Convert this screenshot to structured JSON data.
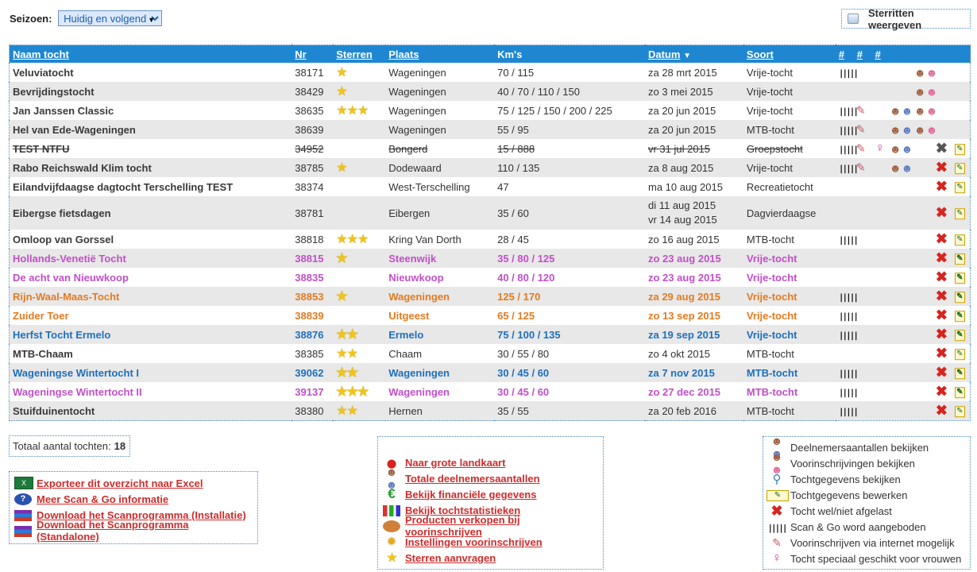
{
  "season": {
    "label": "Seizoen:",
    "selected": "Huidig en volgend"
  },
  "stars_toggle": {
    "label": "Sterritten weergeven"
  },
  "table": {
    "headers": {
      "naam": "Naam tocht",
      "nr": "Nr",
      "sterren": "Sterren",
      "plaats": "Plaats",
      "kms": "Km's",
      "datum": "Datum",
      "soort": "Soort",
      "h1": "#",
      "h2": "#",
      "h3": "#"
    },
    "rows": [
      {
        "naam": "Veluviatocht",
        "nr": "38171",
        "stars": 1,
        "plaats": "Wageningen",
        "kms": "70 / 115",
        "datum": "za 28 mrt 2015",
        "datum2": "",
        "soort": "Vrije-tocht",
        "style": "",
        "bg": 0,
        "icons": {
          "scan": true,
          "pencil": false,
          "female": false,
          "people1": false,
          "people2": true,
          "x": "",
          "edit": false
        }
      },
      {
        "naam": "Bevrijdingstocht",
        "nr": "38429",
        "stars": 1,
        "plaats": "Wageningen",
        "kms": "40 / 70 / 110 / 150",
        "datum": "zo 3 mei 2015",
        "datum2": "",
        "soort": "Vrije-tocht",
        "style": "",
        "bg": 1,
        "icons": {
          "scan": false,
          "pencil": false,
          "female": false,
          "people1": false,
          "people2": true,
          "x": "",
          "edit": false
        }
      },
      {
        "naam": "Jan Janssen Classic",
        "nr": "38635",
        "stars": 3,
        "plaats": "Wageningen",
        "kms": "75 / 125 / 150 / 200 / 225",
        "datum": "za 20 jun 2015",
        "datum2": "",
        "soort": "Vrije-tocht",
        "style": "",
        "bg": 0,
        "icons": {
          "scan": true,
          "pencil": true,
          "female": false,
          "people1": true,
          "people2": true,
          "x": "",
          "edit": false
        }
      },
      {
        "naam": "Hel van Ede-Wageningen",
        "nr": "38639",
        "stars": 0,
        "plaats": "Wageningen",
        "kms": "55 / 95",
        "datum": "za 20 jun 2015",
        "datum2": "",
        "soort": "MTB-tocht",
        "style": "",
        "bg": 1,
        "icons": {
          "scan": true,
          "pencil": true,
          "female": false,
          "people1": true,
          "people2": true,
          "x": "",
          "edit": false
        }
      },
      {
        "naam": "TEST NTFU",
        "nr": "34952",
        "stars": 0,
        "plaats": "Bongerd",
        "kms": "15 / 888",
        "datum": "vr 31 jul 2015",
        "datum2": "",
        "soort": "Groepstocht",
        "style": "strike",
        "bg": 0,
        "icons": {
          "scan": true,
          "pencil": true,
          "female": true,
          "people1": true,
          "people2": false,
          "x": "gray",
          "edit": true
        }
      },
      {
        "naam": "Rabo Reichswald Klim tocht",
        "nr": "38785",
        "stars": 1,
        "plaats": "Dodewaard",
        "kms": "110 / 135",
        "datum": "za 8 aug 2015",
        "datum2": "",
        "soort": "Vrije-tocht",
        "style": "",
        "bg": 1,
        "icons": {
          "scan": true,
          "pencil": true,
          "female": false,
          "people1": true,
          "people2": false,
          "x": "red",
          "edit": true
        }
      },
      {
        "naam": "Eilandvijfdaagse dagtocht Terschelling TEST",
        "nr": "38374",
        "stars": 0,
        "plaats": "West-Terschelling",
        "kms": "47",
        "datum": "ma 10 aug 2015",
        "datum2": "",
        "soort": "Recreatietocht",
        "style": "",
        "bg": 0,
        "icons": {
          "scan": false,
          "pencil": false,
          "female": false,
          "people1": false,
          "people2": false,
          "x": "red",
          "edit": true
        }
      },
      {
        "naam": "Eibergse fietsdagen",
        "nr": "38781",
        "stars": 0,
        "plaats": "Eibergen",
        "kms": "35 / 60",
        "datum": "di 11 aug 2015",
        "datum2": "vr 14 aug 2015",
        "soort": "Dagvierdaagse",
        "style": "tall",
        "bg": 1,
        "icons": {
          "scan": false,
          "pencil": false,
          "female": false,
          "people1": false,
          "people2": false,
          "x": "red",
          "edit": true
        }
      },
      {
        "naam": "Omloop van Gorssel",
        "nr": "38818",
        "stars": 3,
        "plaats": "Kring Van Dorth",
        "kms": "28 / 45",
        "datum": "zo 16 aug 2015",
        "datum2": "",
        "soort": "MTB-tocht",
        "style": "",
        "bg": 0,
        "icons": {
          "scan": true,
          "pencil": false,
          "female": false,
          "people1": false,
          "people2": false,
          "x": "red",
          "edit": true
        }
      },
      {
        "naam": "Hollands-Venetië Tocht",
        "nr": "38815",
        "stars": 1,
        "plaats": "Steenwijk",
        "kms": "35 / 80 / 125",
        "datum": "zo 23 aug 2015",
        "datum2": "",
        "soort": "Vrije-tocht",
        "style": "c-purple",
        "bg": 1,
        "icons": {
          "scan": false,
          "pencil": false,
          "female": false,
          "people1": false,
          "people2": false,
          "x": "red",
          "edit": true
        }
      },
      {
        "naam": "De acht van Nieuwkoop",
        "nr": "38835",
        "stars": 0,
        "plaats": "Nieuwkoop",
        "kms": "40 / 80 / 120",
        "datum": "zo 23 aug 2015",
        "datum2": "",
        "soort": "Vrije-tocht",
        "style": "c-purple",
        "bg": 0,
        "icons": {
          "scan": false,
          "pencil": false,
          "female": false,
          "people1": false,
          "people2": false,
          "x": "red",
          "edit": true
        }
      },
      {
        "naam": "Rijn-Waal-Maas-Tocht",
        "nr": "38853",
        "stars": 1,
        "plaats": "Wageningen",
        "kms": "125 / 170",
        "datum": "za 29 aug 2015",
        "datum2": "",
        "soort": "Vrije-tocht",
        "style": "c-orange",
        "bg": 1,
        "icons": {
          "scan": true,
          "pencil": false,
          "female": false,
          "people1": false,
          "people2": false,
          "x": "red",
          "edit": true
        }
      },
      {
        "naam": "Zuider Toer",
        "nr": "38839",
        "stars": 0,
        "plaats": "Uitgeest",
        "kms": "65 / 125",
        "datum": "zo 13 sep 2015",
        "datum2": "",
        "soort": "Vrije-tocht",
        "style": "c-orange",
        "bg": 0,
        "icons": {
          "scan": true,
          "pencil": false,
          "female": false,
          "people1": false,
          "people2": false,
          "x": "red",
          "edit": true
        }
      },
      {
        "naam": "Herfst Tocht Ermelo",
        "nr": "38876",
        "stars": 2,
        "plaats": "Ermelo",
        "kms": "75 / 100 / 135",
        "datum": "za 19 sep 2015",
        "datum2": "",
        "soort": "Vrije-tocht",
        "style": "c-blue",
        "bg": 1,
        "icons": {
          "scan": true,
          "pencil": false,
          "female": false,
          "people1": false,
          "people2": false,
          "x": "red",
          "edit": true
        }
      },
      {
        "naam": "MTB-Chaam",
        "nr": "38385",
        "stars": 2,
        "plaats": "Chaam",
        "kms": "30 / 55 / 80",
        "datum": "zo 4 okt 2015",
        "datum2": "",
        "soort": "MTB-tocht",
        "style": "",
        "bg": 0,
        "icons": {
          "scan": false,
          "pencil": false,
          "female": false,
          "people1": false,
          "people2": false,
          "x": "red",
          "edit": true
        }
      },
      {
        "naam": "Wageningse Wintertocht I",
        "nr": "39062",
        "stars": 2,
        "plaats": "Wageningen",
        "kms": "30 / 45 / 60",
        "datum": "za 7 nov 2015",
        "datum2": "",
        "soort": "MTB-tocht",
        "style": "c-blue",
        "bg": 1,
        "icons": {
          "scan": true,
          "pencil": false,
          "female": false,
          "people1": false,
          "people2": false,
          "x": "red",
          "edit": true
        }
      },
      {
        "naam": "Wageningse Wintertocht II",
        "nr": "39137",
        "stars": 3,
        "plaats": "Wageningen",
        "kms": "30 / 45 / 60",
        "datum": "zo 27 dec 2015",
        "datum2": "",
        "soort": "MTB-tocht",
        "style": "c-purple",
        "bg": 0,
        "icons": {
          "scan": true,
          "pencil": false,
          "female": false,
          "people1": false,
          "people2": false,
          "x": "red",
          "edit": true
        }
      },
      {
        "naam": "Stuifduinentocht",
        "nr": "38380",
        "stars": 2,
        "plaats": "Hernen",
        "kms": "35 / 55",
        "datum": "za 20 feb 2016",
        "datum2": "",
        "soort": "MTB-tocht",
        "style": "",
        "bg": 1,
        "icons": {
          "scan": true,
          "pencil": false,
          "female": false,
          "people1": false,
          "people2": false,
          "x": "red",
          "edit": true
        }
      }
    ]
  },
  "total": {
    "label": "Totaal aantal tochten:",
    "value": "18"
  },
  "links_left": [
    {
      "icon": "excel-icon",
      "label": "Exporteer dit overzicht naar Excel"
    },
    {
      "icon": "help-icon",
      "label": "Meer Scan & Go informatie"
    },
    {
      "icon": "archive-icon",
      "label": "Download het Scanprogramma (Installatie)"
    },
    {
      "icon": "archive-icon",
      "label": "Download het Scanprogramma (Standalone)"
    }
  ],
  "links_mid": [
    {
      "icon": "map-pin-icon",
      "label": "Naar grote landkaart"
    },
    {
      "icon": "people-icon",
      "label": "Totale deelnemersaantallen"
    },
    {
      "icon": "euro-icon",
      "label": "Bekijk financiële gegevens"
    },
    {
      "icon": "bar-chart-icon",
      "label": "Bekijk tochtstatistieken"
    },
    {
      "icon": "product-icon",
      "label": "Producten verkopen bij voorinschrijven"
    },
    {
      "icon": "gear-icon",
      "label": "Instellingen voorinschrijven"
    },
    {
      "icon": "star-icon",
      "label": "Sterren aanvragen"
    }
  ],
  "legend": [
    {
      "icon": "participants-icon",
      "label": "Deelnemersaantallen bekijken"
    },
    {
      "icon": "preregistrations-icon",
      "label": "Voorinschrijvingen bekijken"
    },
    {
      "icon": "magnifier-icon",
      "label": "Tochtgegevens bekijken"
    },
    {
      "icon": "edit-icon",
      "label": "Tochtgegevens bewerken"
    },
    {
      "icon": "cancel-x-icon",
      "label": "Tocht wel/niet afgelast"
    },
    {
      "icon": "barcode-icon",
      "label": "Scan & Go word aangeboden"
    },
    {
      "icon": "pencil-icon",
      "label": "Voorinschrijven via internet mogelijk"
    },
    {
      "icon": "female-icon",
      "label": "Tocht speciaal geschikt voor vrouwen"
    }
  ]
}
